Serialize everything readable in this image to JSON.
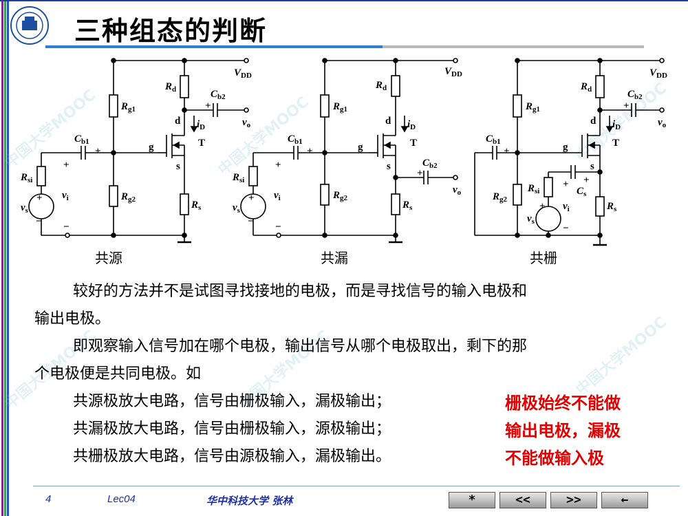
{
  "slide": {
    "title": "三种组态的判断",
    "captions": [
      "共源",
      "共漏",
      "共栅"
    ],
    "labels": {
      "vdd": "V",
      "vdd_sub": "DD",
      "rg1": "R",
      "rg1_sub": "g1",
      "rg2": "R",
      "rg2_sub": "g2",
      "rd": "R",
      "rd_sub": "d",
      "rs": "R",
      "rs_sub": "s",
      "rsi": "R",
      "rsi_sub": "si",
      "cb1": "C",
      "cb1_sub": "b1",
      "cb2": "C",
      "cb2_sub": "b2",
      "cs": "C",
      "cs_sub": "s",
      "vo": "v",
      "vo_sub": "o",
      "vi": "v",
      "vi_sub": "i",
      "vs": "v",
      "vs_sub": "s",
      "id": "i",
      "id_sub": "D",
      "d": "d",
      "g": "g",
      "s": "s",
      "t": "T",
      "plus": "+",
      "minus": "−"
    },
    "paragraphs": [
      "较好的方法并不是试图寻找接地的电极，而是寻找信号的输入电极和",
      "输出电极。",
      "即观察输入信号加在哪个电极，输出信号从哪个电极取出，剩下的那",
      "个电极便是共同电极。如",
      "共源极放大电路，信号由栅极输入，漏极输出；",
      "共漏极放大电路，信号由栅极输入，源极输出；",
      "共栅极放大电路，信号由源极输入，漏极输出。"
    ],
    "notes": [
      "栅极始终不能做",
      "输出电极，漏极",
      "不能做输入极"
    ]
  },
  "footer": {
    "page": "4",
    "lecture": "Lec04",
    "school": "华中科技大学   张林",
    "nav_buttons": [
      "*",
      "<<",
      ">>",
      "←"
    ]
  },
  "watermark": "中国大学MOOC",
  "colors": {
    "accent_blue": "#2f7fd0",
    "note_red": "#e00000",
    "footer_blue": "#1c2fa8"
  }
}
